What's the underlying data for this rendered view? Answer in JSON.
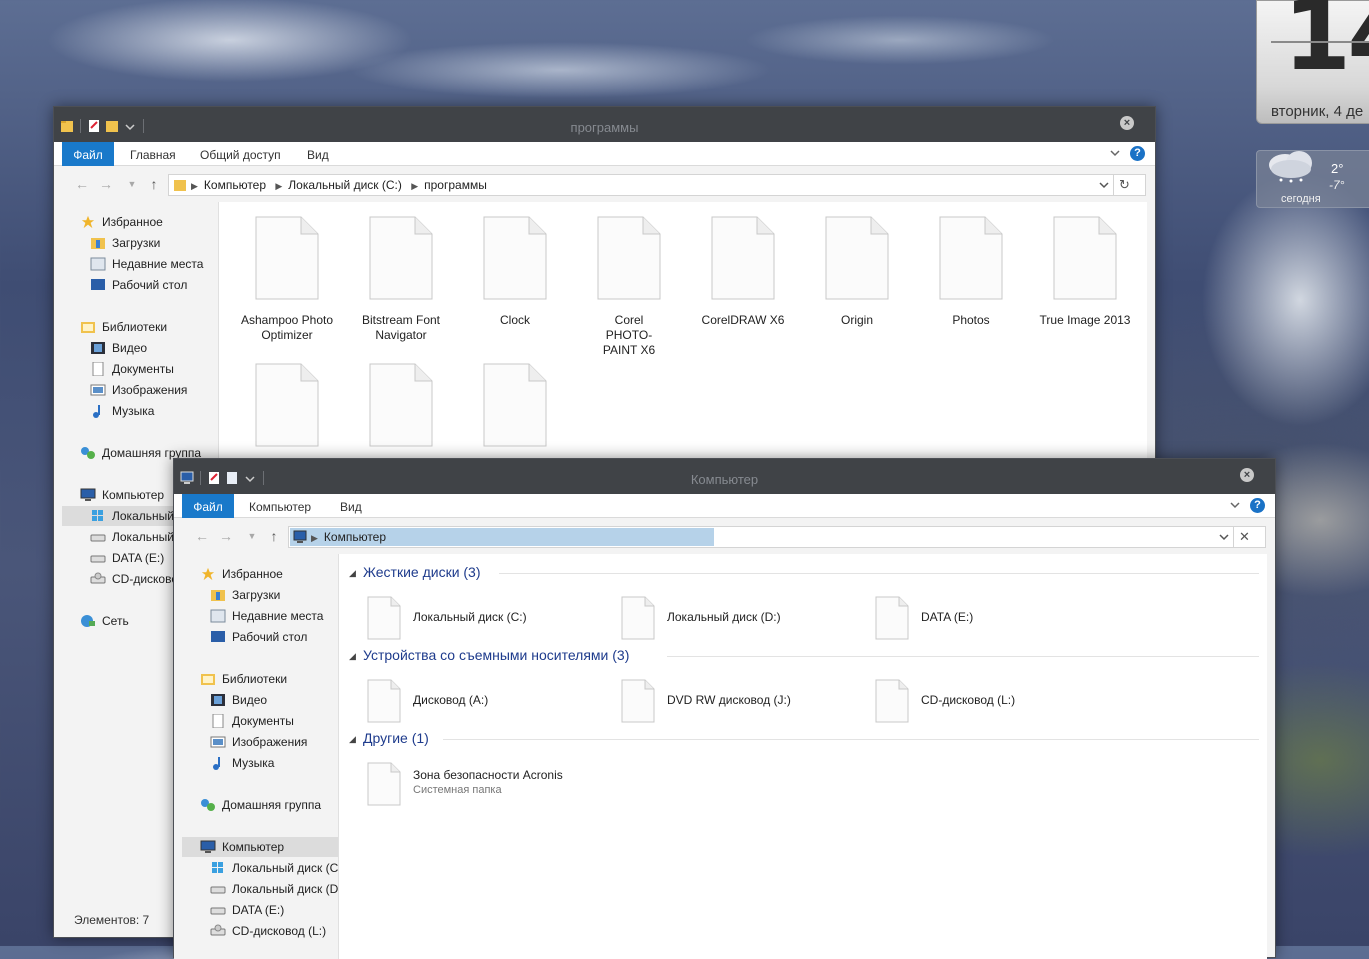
{
  "gadgets": {
    "clock": {
      "day": "14",
      "date_text": "вторник, 4 де"
    },
    "weather": {
      "high": "2°",
      "low": "-7°",
      "day": "сегодня"
    }
  },
  "window_programs": {
    "title": "программы",
    "ribbon": {
      "file": "Файл",
      "home": "Главная",
      "share": "Общий доступ",
      "view": "Вид"
    },
    "address": [
      "Компьютер",
      "Локальный диск (C:)",
      "программы"
    ],
    "nav": {
      "favorites": "Избранное",
      "downloads": "Загрузки",
      "recent": "Недавние места",
      "desktop": "Рабочий стол",
      "libraries": "Библиотеки",
      "video": "Видео",
      "documents": "Документы",
      "images": "Изображения",
      "music": "Музыка",
      "homegroup": "Домашняя группа",
      "computer": "Компьютер",
      "local_c": "Локальный",
      "local_d": "Локальный",
      "data_e": "DATA (E:)",
      "cd_l": "CD-дисково",
      "network": "Сеть"
    },
    "files": [
      "Ashampoo Photo Optimizer",
      "Bitstream Font Navigator",
      "Clock",
      "Corel PHOTO-PAINT X6",
      "CorelDRAW X6",
      "Origin",
      "Photos",
      "True Image 2013"
    ],
    "status": "Элементов: 7"
  },
  "window_computer": {
    "title": "Компьютер",
    "ribbon": {
      "file": "Файл",
      "computer": "Компьютер",
      "view": "Вид"
    },
    "address": [
      "Компьютер"
    ],
    "nav": {
      "favorites": "Избранное",
      "downloads": "Загрузки",
      "recent": "Недавние места",
      "desktop": "Рабочий стол",
      "libraries": "Библиотеки",
      "video": "Видео",
      "documents": "Документы",
      "images": "Изображения",
      "music": "Музыка",
      "homegroup": "Домашняя группа",
      "computer": "Компьютер",
      "local_c": "Локальный диск (C",
      "local_d": "Локальный диск (D",
      "data_e": "DATA (E:)",
      "cd_l": "CD-дисковод (L:)"
    },
    "groups": {
      "hard_drives": {
        "label": "Жесткие диски (3)",
        "items": [
          "Локальный диск (C:)",
          "Локальный диск (D:)",
          "DATA (E:)"
        ]
      },
      "removable": {
        "label": "Устройства со съемными носителями (3)",
        "items": [
          "Дисковод (A:)",
          "DVD RW дисковод (J:)",
          "CD-дисковод (L:)"
        ]
      },
      "other": {
        "label": "Другие (1)",
        "item_name": "Зона безопасности Acronis",
        "item_sub": "Системная папка"
      }
    }
  }
}
